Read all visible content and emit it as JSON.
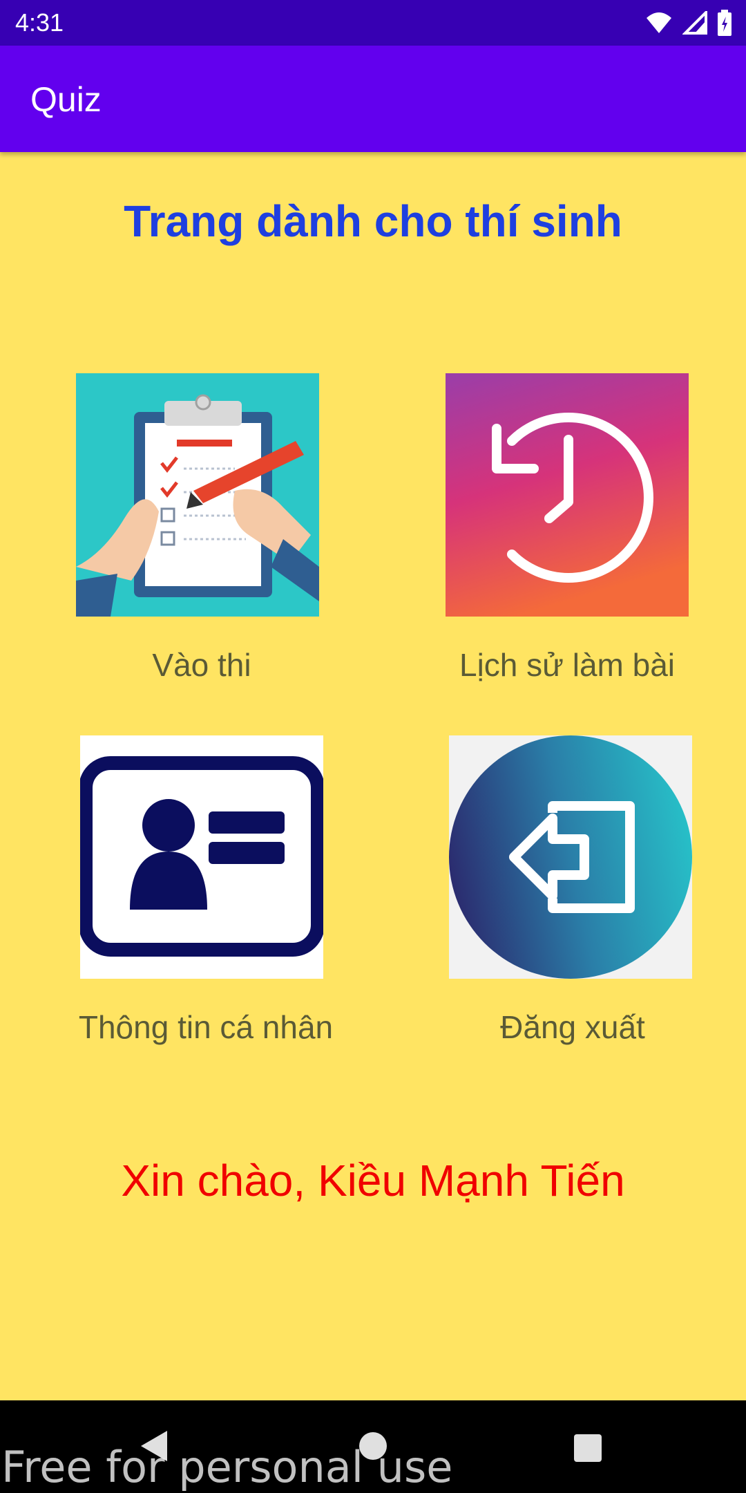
{
  "status_bar": {
    "time": "4:31"
  },
  "app_bar": {
    "title": "Quiz"
  },
  "page": {
    "heading": "Trang dành cho thí sinh"
  },
  "tiles": [
    {
      "label": "Vào thi",
      "icon": "clipboard-exam-icon"
    },
    {
      "label": "Lịch sử làm bài",
      "icon": "history-clock-icon"
    },
    {
      "label": "Thông tin cá nhân",
      "icon": "id-card-icon"
    },
    {
      "label": "Đăng xuất",
      "icon": "logout-icon"
    }
  ],
  "greeting": "Xin chào, Kiều Mạnh Tiến",
  "watermark": "Free for personal use",
  "colors": {
    "status_bar": "#3700B3",
    "app_bar": "#6200EE",
    "background": "#FFE462",
    "heading": "#1E3FE0",
    "greeting": "#F00000"
  }
}
